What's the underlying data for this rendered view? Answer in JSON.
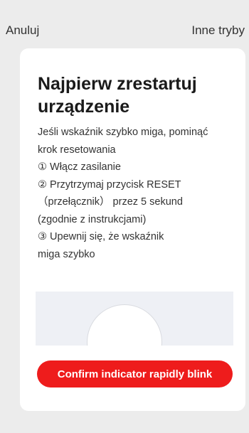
{
  "header": {
    "cancel_label": "Anuluj",
    "other_modes_label": "Inne tryby"
  },
  "card": {
    "title": "Najpierw zrestartuj urządzenie",
    "instructions": [
      "Jeśli wskaźnik szybko miga, pominąć",
      "krok resetowania",
      "① Włącz zasilanie",
      "② Przytrzymaj przycisk RESET",
      "（przełącznik） przez 5 sekund",
      "(zgodnie z instrukcjami)",
      "③ Upewnij się, że wskaźnik",
      "miga szybko"
    ],
    "illustration_icon": "device-illustration",
    "confirm_label": "Confirm indicator rapidly blink"
  },
  "colors": {
    "background": "#ececec",
    "card": "#ffffff",
    "accent": "#ee1c1c",
    "illustration_bg": "#eef0f5"
  }
}
